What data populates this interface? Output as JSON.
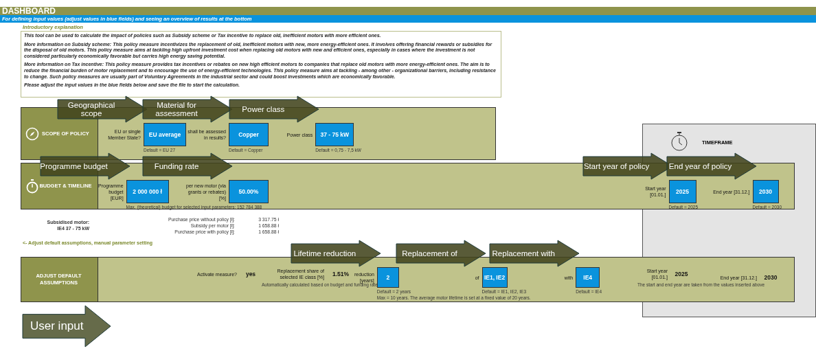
{
  "header": {
    "title": "DASHBOARD",
    "subtitle": "For defining input values (adjust values in blue fields) and seeing an overview of results at the bottom"
  },
  "intro": {
    "heading": "Introductory explanation",
    "paragraphs": [
      "This tool can be used to calculate the impact of policies such as Subsidy scheme or Tax incentive to replace old, inefficient motors with more efficient ones.",
      "More information on Subsidy scheme: This policy measure incentivizes the replacement of old, inefficient motors with new, more energy-efficient ones. It involves offering financial rewards or subsidies for the disposal of old motors. This policy measure aims at tackling high upfront investment cost when replacing old motors with new and efficient ones, especially in cases where the investment is not considered particularly economically favorable but carries high energy saving potential.",
      "More information on Tax incentive: This policy measure provides tax incentives or rebates on new high efficient motors to companies that replace old motors with more energy-efficient ones. The aim is to reduce the financial burden of motor replacement and to encourage the use of energy-efficient technologies. This policy measure aims at tackling - among other - organizational barriers, including resistance to change. Such policy measures are usually part of Voluntary Agreements in the industrial sector and could boost investments which are economically favorable.",
      "Please adjust the input values in the blue fields below and save the file to start the calculation."
    ]
  },
  "timeframe": {
    "title": "TIMEFRAME"
  },
  "panels": [
    {
      "title": "SCOPE OF POLICY",
      "fields": [
        {
          "kind": "input",
          "label": "EU or single Member State?",
          "value": "EU average",
          "notes": [
            "Default = EU 27"
          ],
          "callout": "Geographical scope"
        },
        {
          "kind": "input",
          "label": "shall be assessed in results?",
          "value": "Copper",
          "notes": [
            "Default = Copper"
          ],
          "callout": "Material for assessment"
        },
        {
          "kind": "input",
          "label": "Power class",
          "value": "37 - 75 kW",
          "notes": [
            "Default = 0,75 - 7,5 kW"
          ],
          "callout": "Power class"
        }
      ]
    },
    {
      "title": "BUDGET & TIMELINE",
      "fields": [
        {
          "kind": "input",
          "label": "Programme budget [EUR]",
          "value": "2 000 000 ł",
          "notes": [
            "Max. (theoretical) budget for selected input parameters: 152 784 388"
          ],
          "callout": "Programme budget"
        },
        {
          "kind": "input",
          "label": "per new motor (via grants or rebates) [%]",
          "value": "50.00%",
          "callout": "Funding rate"
        }
      ],
      "timeframe_fields": [
        {
          "kind": "input",
          "label": "Start year [01.01.]",
          "value": "2025",
          "notes": [
            "Default = 2025"
          ],
          "callout": "Start year of policy"
        },
        {
          "kind": "input",
          "label": "End year [31.12.]",
          "value": "2030",
          "notes": [
            "Default = 2030"
          ],
          "callout": "End year of policy"
        }
      ]
    },
    {
      "title": "ADJUST DEFAULT ASSUMPTIONS",
      "fields": [
        {
          "kind": "value",
          "label": "Activate measure?",
          "value": "yes"
        },
        {
          "kind": "value",
          "label": "Replacement share of selected IE class [%]",
          "value": "1.51%",
          "notes": [
            "Automatically calculated based on budget and funding rate."
          ]
        },
        {
          "kind": "input",
          "label": "reduction [years]",
          "value": "2",
          "notes": [
            "Default = 2 years",
            "Max = 10 years. The average motor lifetime is set at a fixed value of 20 years."
          ],
          "callout": "Lifetime reduction"
        },
        {
          "kind": "input",
          "label": "of",
          "value": "IE1, IE2",
          "notes": [
            "Default = IE1, IE2, IE3"
          ],
          "callout": "Replacement of"
        },
        {
          "kind": "input",
          "label": "with",
          "value": "IE4",
          "notes": [
            "Default = IE4"
          ],
          "callout": "Replacement with"
        }
      ],
      "timeframe_fields": [
        {
          "kind": "value",
          "label": "Start year [01.01.]",
          "value": "2025",
          "notes": [
            "The start and end year are taken from the values inserted above"
          ]
        },
        {
          "kind": "value",
          "label": "End year [31.12.]",
          "value": "2030"
        }
      ]
    }
  ],
  "results": {
    "motor_label": "Subsidised motor:",
    "motor": "IE4 37 - 75 kW",
    "rows": [
      {
        "label": "Purchase price without policy [ł]:",
        "value": "3 317.75 ł"
      },
      {
        "label": "Subsidy per motor [ł]:",
        "value": "1 658.88 ł"
      },
      {
        "label": "Purchase price with policy [ł]:",
        "value": "1 658.88 ł"
      }
    ]
  },
  "link": "<- Adjust default assumptions, manual parameter setting",
  "user_input": "User input"
}
